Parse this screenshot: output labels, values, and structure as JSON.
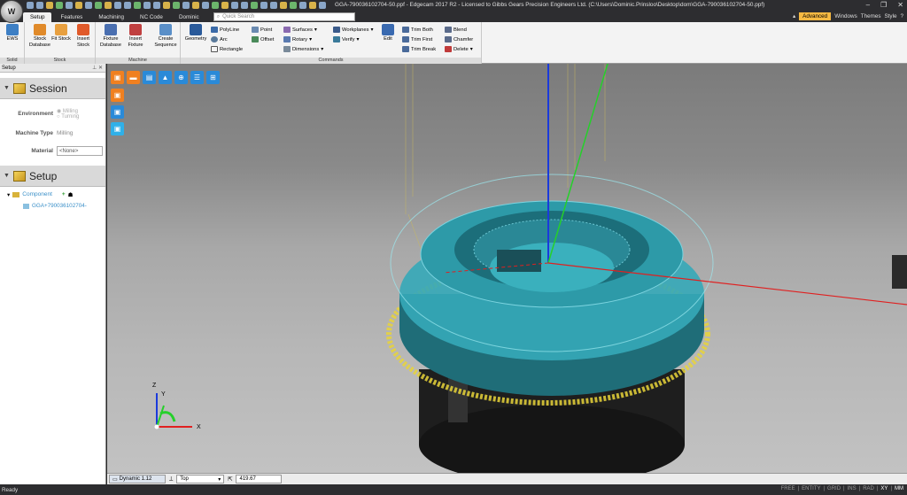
{
  "titlebar": {
    "title": "GGA-790036102704-50.ppf - Edgecam 2017 R2  - Licensed to Gibbs Gears Precision Engineers Ltd. (C:\\Users\\Dominic.Prinsloo\\Desktop\\dom\\GGA-790036102704-50.ppf)",
    "minimize": "–",
    "restore": "❐",
    "close": "✕"
  },
  "tabs": [
    "Setup",
    "Features",
    "Machining",
    "NC Code",
    "Dominic"
  ],
  "search": {
    "placeholder": "Quick Search"
  },
  "tabs_right": {
    "advanced": "Advanced",
    "windows": "Windows",
    "themes": "Themes",
    "style": "Style"
  },
  "ribbon": {
    "groups": {
      "solid": "Solid",
      "stock": "Stock",
      "machine": "Machine",
      "commands": "Commands"
    },
    "ews": "EWS",
    "stock_database": "Stock Database",
    "fit_stock": "Fit Stock",
    "insert_stock": "Insert Stock",
    "fixture_database": "Fixture Database",
    "insert_fixture": "Insert Fixture",
    "create_sequence": "Create Sequence",
    "geometry": "Geometry",
    "polyline": "PolyLine",
    "arc": "Arc",
    "rectangle": "Rectangle",
    "point": "Point",
    "offset": "Offset",
    "surfaces": "Surfaces",
    "rotary": "Rotary",
    "dimensions": "Dimensions",
    "workplanes": "Workplanes",
    "verify": "Verify",
    "edit": "Edit",
    "trim_both": "Trim Both",
    "trim_first": "Trim First",
    "trim_break": "Trim Break",
    "blend": "Blend",
    "chamfer": "Chamfer",
    "delete": "Delete"
  },
  "left_panel": {
    "title": "Setup",
    "session": {
      "heading": "Session",
      "environment_label": "Environment",
      "env_options": [
        "Milling",
        "Turning"
      ],
      "machine_type_label": "Machine Type",
      "machine_type_value": "Milling",
      "material_label": "Material",
      "material_value": "<None>"
    },
    "setup": {
      "heading": "Setup",
      "component_label": "Component",
      "component_item": "GGA+790036102704-"
    }
  },
  "bottom_bar": {
    "dynamic": "Dynamic 1.12",
    "view": "Top",
    "zoom": "419.67"
  },
  "status": {
    "ready": "Ready",
    "flags": [
      "FREE",
      "ENTITY",
      "GRID",
      "INS",
      "RAD",
      "XY",
      "MM"
    ]
  },
  "triad": {
    "x": "X",
    "y": "Y",
    "z": "Z"
  },
  "colors": {
    "accent": "#f6b942",
    "viewport_top": "#7b7b7b",
    "viewport_bottom": "#c2c2c2",
    "part_teal": "#35a9b8",
    "toolpath_yellow": "#e8d43a"
  }
}
